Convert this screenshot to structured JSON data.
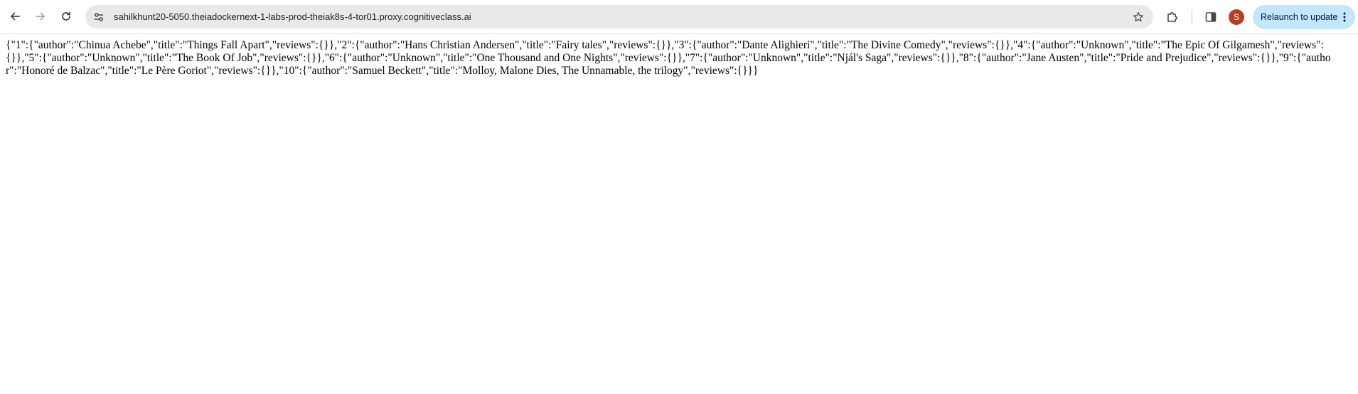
{
  "browser": {
    "address_bar": {
      "url": "sahilkhunt20-5050.theiadockernext-1-labs-prod-theiak8s-4-tor01.proxy.cognitiveclass.ai"
    },
    "profile": {
      "initial": "S",
      "color": "#b5401f"
    },
    "relaunch_button": {
      "label": "Relaunch to update",
      "color": "#c2e7ff"
    },
    "icons": {
      "back": "arrow-left-icon",
      "forward": "arrow-right-icon",
      "reload": "reload-icon",
      "site_info": "tune-icon",
      "bookmark": "star-icon",
      "extensions": "puzzle-icon",
      "side_panel": "side-panel-icon",
      "menu": "kebab-menu-icon"
    }
  },
  "page": {
    "json_body": "{\"1\":{\"author\":\"Chinua Achebe\",\"title\":\"Things Fall Apart\",\"reviews\":{}},\"2\":{\"author\":\"Hans Christian Andersen\",\"title\":\"Fairy tales\",\"reviews\":{}},\"3\":{\"author\":\"Dante Alighieri\",\"title\":\"The Divine Comedy\",\"reviews\":{}},\"4\":{\"author\":\"Unknown\",\"title\":\"The Epic Of Gilgamesh\",\"reviews\":{}},\"5\":{\"author\":\"Unknown\",\"title\":\"The Book Of Job\",\"reviews\":{}},\"6\":{\"author\":\"Unknown\",\"title\":\"One Thousand and One Nights\",\"reviews\":{}},\"7\":{\"author\":\"Unknown\",\"title\":\"Njál's Saga\",\"reviews\":{}},\"8\":{\"author\":\"Jane Austen\",\"title\":\"Pride and Prejudice\",\"reviews\":{}},\"9\":{\"author\":\"Honoré de Balzac\",\"title\":\"Le Père Goriot\",\"reviews\":{}},\"10\":{\"author\":\"Samuel Beckett\",\"title\":\"Molloy, Malone Dies, The Unnamable, the trilogy\",\"reviews\":{}}}"
  }
}
